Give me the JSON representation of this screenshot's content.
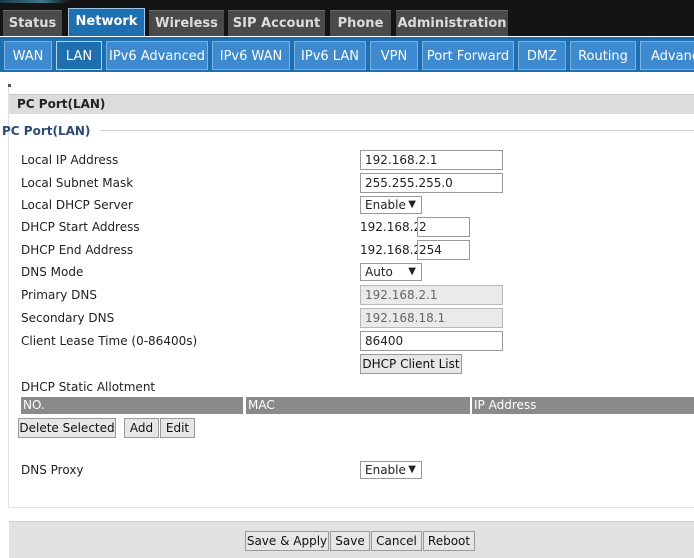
{
  "main_tabs": [
    {
      "label": "Status"
    },
    {
      "label": "Network",
      "active": true
    },
    {
      "label": "Wireless"
    },
    {
      "label": "SIP Account"
    },
    {
      "label": "Phone"
    },
    {
      "label": "Administration"
    }
  ],
  "sub_tabs": [
    {
      "label": "WAN"
    },
    {
      "label": "LAN",
      "active": true
    },
    {
      "label": "IPv6 Advanced"
    },
    {
      "label": "IPv6 WAN"
    },
    {
      "label": "IPv6 LAN"
    },
    {
      "label": "VPN"
    },
    {
      "label": "Port Forward"
    },
    {
      "label": "DMZ"
    },
    {
      "label": "Routing"
    },
    {
      "label": "Advance"
    }
  ],
  "section": {
    "title": "PC Port(LAN)",
    "legend": "PC Port(LAN)"
  },
  "form": {
    "local_ip": {
      "label": "Local IP Address",
      "value": "192.168.2.1"
    },
    "subnet_mask": {
      "label": "Local Subnet Mask",
      "value": "255.255.255.0"
    },
    "dhcp_server": {
      "label": "Local DHCP Server",
      "value": "Enable"
    },
    "dhcp_start": {
      "label": "DHCP Start Address",
      "prefix": "192.168.2.",
      "value": "2"
    },
    "dhcp_end": {
      "label": "DHCP End Address",
      "prefix": "192.168.2.",
      "value": "254"
    },
    "dns_mode": {
      "label": "DNS Mode",
      "value": "Auto"
    },
    "primary_dns": {
      "label": "Primary DNS",
      "value": "192.168.2.1"
    },
    "secondary_dns": {
      "label": "Secondary DNS",
      "value": "192.168.18.1"
    },
    "lease_time": {
      "label": "Client Lease Time (0-86400s)",
      "value": "86400"
    },
    "dhcp_client_list_button": "DHCP Client List",
    "static_allotment_label": "DHCP Static Allotment",
    "dns_proxy": {
      "label": "DNS Proxy",
      "value": "Enable"
    }
  },
  "static_table": {
    "columns": [
      "NO.",
      "MAC",
      "IP Address"
    ]
  },
  "table_buttons": {
    "delete_selected": "Delete Selected",
    "add": "Add",
    "edit": "Edit"
  },
  "footer_buttons": {
    "save_apply": "Save & Apply",
    "save": "Save",
    "cancel": "Cancel",
    "reboot": "Reboot"
  },
  "colors": {
    "active_tab": "#1d6fb0",
    "sub_tab": "#3d8ad0",
    "inactive_main_tab": "#4a4a4a",
    "legend_text": "#2b4a7a"
  },
  "icons": {
    "dropdown": "triangle-down"
  }
}
